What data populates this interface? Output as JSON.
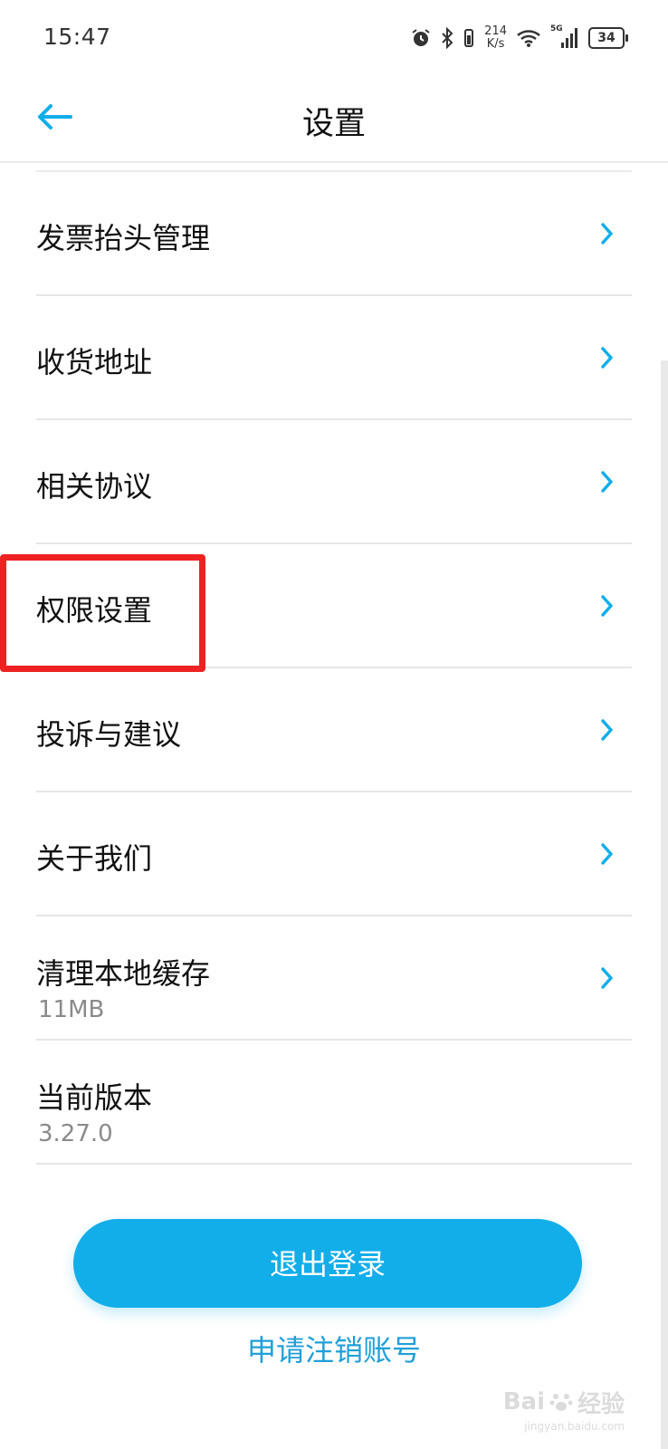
{
  "status_bar": {
    "time": "15:47",
    "speed_value": "214",
    "speed_unit": "K/s",
    "network": "5G",
    "battery": "34",
    "icons": [
      "alarm-icon",
      "bluetooth-icon",
      "vibrate-icon",
      "wifi-icon",
      "signal-icon",
      "battery-icon"
    ]
  },
  "header": {
    "title": "设置",
    "back_icon": "arrow-left-icon"
  },
  "settings": {
    "items": [
      {
        "label": "发票抬头管理"
      },
      {
        "label": "收货地址"
      },
      {
        "label": "相关协议"
      },
      {
        "label": "权限设置"
      },
      {
        "label": "投诉与建议"
      },
      {
        "label": "关于我们"
      },
      {
        "label": "清理本地缓存",
        "sub": "11MB"
      },
      {
        "label": "当前版本",
        "sub": "3.27.0"
      }
    ]
  },
  "actions": {
    "logout": "退出登录",
    "deregister": "申请注销账号"
  },
  "watermark": {
    "brand": "Bai",
    "brand_cn": "经验",
    "url": "jingyan.baidu.com"
  },
  "colors": {
    "accent": "#12aee9",
    "link": "#1f9fd9",
    "highlight": "#ee2222"
  }
}
